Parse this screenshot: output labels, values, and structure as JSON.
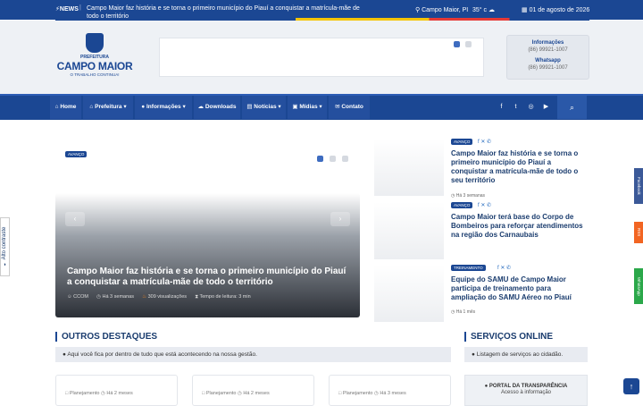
{
  "topbar": {
    "news_label": "NEWS",
    "ticker": "Campo Maior faz história e se torna o primeiro município do Piauí a conquistar a matrícula-mãe de todo o território",
    "location": "Campo Maior, PI",
    "temperature": "35° c",
    "date": "01 de agosto de 2026"
  },
  "logo": {
    "prefix": "PREFEITURA",
    "name": "CAMPO MAIOR",
    "slogan": "O TRABALHO CONTINUA!"
  },
  "contact": {
    "label1": "Informações",
    "value1": "(86) 99921-1007",
    "label2": "Whatsapp",
    "value2": "(86) 99921-1007"
  },
  "nav": {
    "items": [
      "Home",
      "Prefeitura",
      "Informações",
      "Downloads",
      "Notícias",
      "Mídias",
      "Contato"
    ]
  },
  "slide": {
    "badge": "AVANÇO",
    "title": "Campo Maior faz história e se torna o primeiro município do Piauí a conquistar a matrícula-mãe de todo o território",
    "author": "CCOM",
    "time": "Há 3 semanas",
    "views": "309 visualizações",
    "reading": "Tempo de leitura: 3 min"
  },
  "news": [
    {
      "badge": "AVANÇO",
      "title": "Campo Maior faz história e se torna o primeiro município do Piauí a conquistar a matrícula-mãe de todo o seu território",
      "time": "Há 3 semanas"
    },
    {
      "badge": "AVANÇO",
      "title": "Campo Maior terá base do Corpo de Bombeiros para reforçar atendimentos na região dos Carnaubais",
      "time": "Há 3 semanas"
    },
    {
      "badge": "TREINAMENTO",
      "title": "Equipe do SAMU de Campo Maior participa de treinamento para ampliação do SAMU Aéreo no Piauí",
      "time": "Há 1 mês"
    }
  ],
  "outros": {
    "title": "OUTROS DESTAQUES",
    "info": "Aqui você fica por dentro de tudo que está acontecendo na nossa gestão.",
    "cards": [
      {
        "cat": "Planejamento",
        "time": "Há 2 meses"
      },
      {
        "cat": "Planejamento",
        "time": "Há 2 meses"
      },
      {
        "cat": "Planejamento",
        "time": "Há 3 meses"
      }
    ]
  },
  "servicos": {
    "title": "SERVIÇOS ONLINE",
    "info": "Listagem de serviços ao cidadão.",
    "portal_title": "PORTAL DA TRANSPARÊNCIA",
    "portal_sub": "Acesso à informação"
  },
  "side": {
    "contrast": "Alto contraste",
    "facebook": "Facebook",
    "rss": "RSS",
    "whatsapp": "WhatsApp"
  },
  "colors": {
    "brand": "#1b4793",
    "accent": "#f5c400"
  }
}
